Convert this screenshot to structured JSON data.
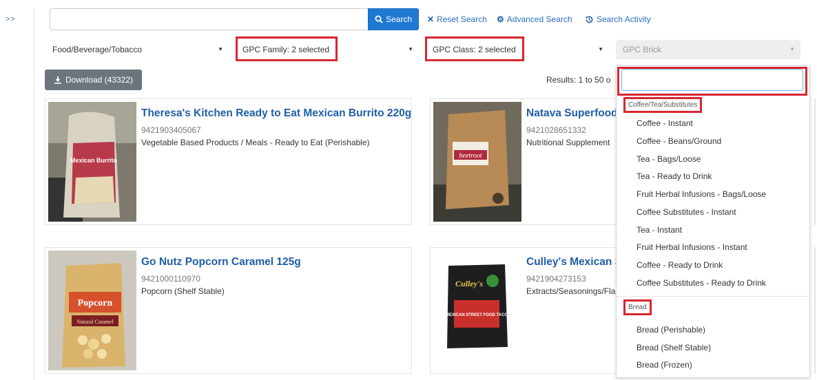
{
  "nav": {
    "toggle": ">>"
  },
  "search": {
    "placeholder": "",
    "button_label": "Search",
    "reset_label": "Reset Search",
    "advanced_label": "Advanced Search",
    "activity_label": "Search Activity"
  },
  "filters": {
    "segment": "Food/Beverage/Tobacco",
    "family": "GPC Family: 2 selected",
    "class": "GPC Class: 2 selected",
    "brick": "GPC Brick"
  },
  "download": {
    "label": "Download (43322)"
  },
  "results": {
    "text": "Results: 1 to 50 o"
  },
  "products": [
    {
      "title": "Theresa's Kitchen Ready to Eat Mexican Burrito 220g",
      "code": "9421903405067",
      "category": "Vegetable Based Products / Meals - Ready to Eat (Perishable)"
    },
    {
      "title": "Natava Superfood",
      "code": "9421028651332",
      "category": "Nutritional Supplement"
    },
    {
      "title": "Go Nutz Popcorn Caramel 125g",
      "code": "9421000110970",
      "category": "Popcorn (Shelf Stable)"
    },
    {
      "title": "Culley's Mexican S",
      "code": "9421904273153",
      "category": "Extracts/Seasonings/Fla"
    }
  ],
  "dropdown": {
    "search_value": "",
    "groups": [
      {
        "label": "Coffee/Tea/Substitutes",
        "options": [
          "Coffee - Instant",
          "Coffee - Beans/Ground",
          "Tea - Bags/Loose",
          "Tea - Ready to Drink",
          "Fruit Herbal Infusions - Bags/Loose",
          "Coffee Substitutes - Instant",
          "Tea - Instant",
          "Fruit Herbal Infusions - Instant",
          "Coffee - Ready to Drink",
          "Coffee Substitutes - Ready to Drink"
        ]
      },
      {
        "label": "Bread",
        "options": [
          "Bread (Perishable)",
          "Bread (Shelf Stable)",
          "Bread (Frozen)"
        ]
      }
    ]
  },
  "images": {
    "burrito_label": "Mexican Burrito",
    "beetroot_label": "beetroot",
    "popcorn_label": "Popcorn",
    "popcorn_sub": "Natural Caramel",
    "culleys_label": "Culley's",
    "culleys_sub": "MEXICAN STREET FOOD TACO"
  },
  "colors": {
    "accent": "#1f78d1",
    "highlight": "#d7262e",
    "link": "#1f5ea8"
  }
}
